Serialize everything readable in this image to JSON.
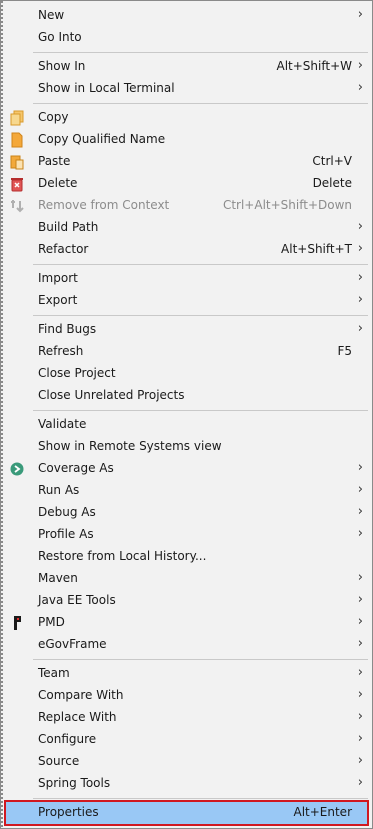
{
  "menu": {
    "groups": [
      [
        {
          "label": "New",
          "shortcut": "",
          "submenu": true
        },
        {
          "label": "Go Into",
          "shortcut": "",
          "submenu": false
        }
      ],
      [
        {
          "label": "Show In",
          "shortcut": "Alt+Shift+W",
          "submenu": true
        },
        {
          "label": "Show in Local Terminal",
          "shortcut": "",
          "submenu": true
        }
      ],
      [
        {
          "label": "Copy",
          "shortcut": "",
          "submenu": false,
          "icon": "copy-icon"
        },
        {
          "label": "Copy Qualified Name",
          "shortcut": "",
          "submenu": false,
          "icon": "copy-qualified-name-icon"
        },
        {
          "label": "Paste",
          "shortcut": "Ctrl+V",
          "submenu": false,
          "icon": "paste-icon"
        },
        {
          "label": "Delete",
          "shortcut": "Delete",
          "submenu": false,
          "icon": "delete-icon"
        },
        {
          "label": "Remove from Context",
          "shortcut": "Ctrl+Alt+Shift+Down",
          "submenu": false,
          "icon": "remove-from-context-icon",
          "disabled": true
        },
        {
          "label": "Build Path",
          "shortcut": "",
          "submenu": true
        },
        {
          "label": "Refactor",
          "shortcut": "Alt+Shift+T",
          "submenu": true
        }
      ],
      [
        {
          "label": "Import",
          "shortcut": "",
          "submenu": true
        },
        {
          "label": "Export",
          "shortcut": "",
          "submenu": true
        }
      ],
      [
        {
          "label": "Find Bugs",
          "shortcut": "",
          "submenu": true
        },
        {
          "label": "Refresh",
          "shortcut": "F5",
          "submenu": false
        },
        {
          "label": "Close Project",
          "shortcut": "",
          "submenu": false
        },
        {
          "label": "Close Unrelated Projects",
          "shortcut": "",
          "submenu": false
        }
      ],
      [
        {
          "label": "Validate",
          "shortcut": "",
          "submenu": false
        },
        {
          "label": "Show in Remote Systems view",
          "shortcut": "",
          "submenu": false
        },
        {
          "label": "Coverage As",
          "shortcut": "",
          "submenu": true,
          "icon": "coverage-icon"
        },
        {
          "label": "Run As",
          "shortcut": "",
          "submenu": true
        },
        {
          "label": "Debug As",
          "shortcut": "",
          "submenu": true
        },
        {
          "label": "Profile As",
          "shortcut": "",
          "submenu": true
        },
        {
          "label": "Restore from Local History...",
          "shortcut": "",
          "submenu": false
        },
        {
          "label": "Maven",
          "shortcut": "",
          "submenu": true
        },
        {
          "label": "Java EE Tools",
          "shortcut": "",
          "submenu": true
        },
        {
          "label": "PMD",
          "shortcut": "",
          "submenu": true,
          "icon": "pmd-icon"
        },
        {
          "label": "eGovFrame",
          "shortcut": "",
          "submenu": true
        }
      ],
      [
        {
          "label": "Team",
          "shortcut": "",
          "submenu": true
        },
        {
          "label": "Compare With",
          "shortcut": "",
          "submenu": true
        },
        {
          "label": "Replace With",
          "shortcut": "",
          "submenu": true
        },
        {
          "label": "Configure",
          "shortcut": "",
          "submenu": true
        },
        {
          "label": "Source",
          "shortcut": "",
          "submenu": true
        },
        {
          "label": "Spring Tools",
          "shortcut": "",
          "submenu": true
        }
      ],
      [
        {
          "label": "Properties",
          "shortcut": "Alt+Enter",
          "submenu": false,
          "selected": true
        }
      ]
    ],
    "chevron": "›"
  },
  "colors": {
    "background": "#f2f2f2",
    "selected": "#99c8f5",
    "selected_outline": "#d01820",
    "disabled_text": "#8c8c8c"
  }
}
